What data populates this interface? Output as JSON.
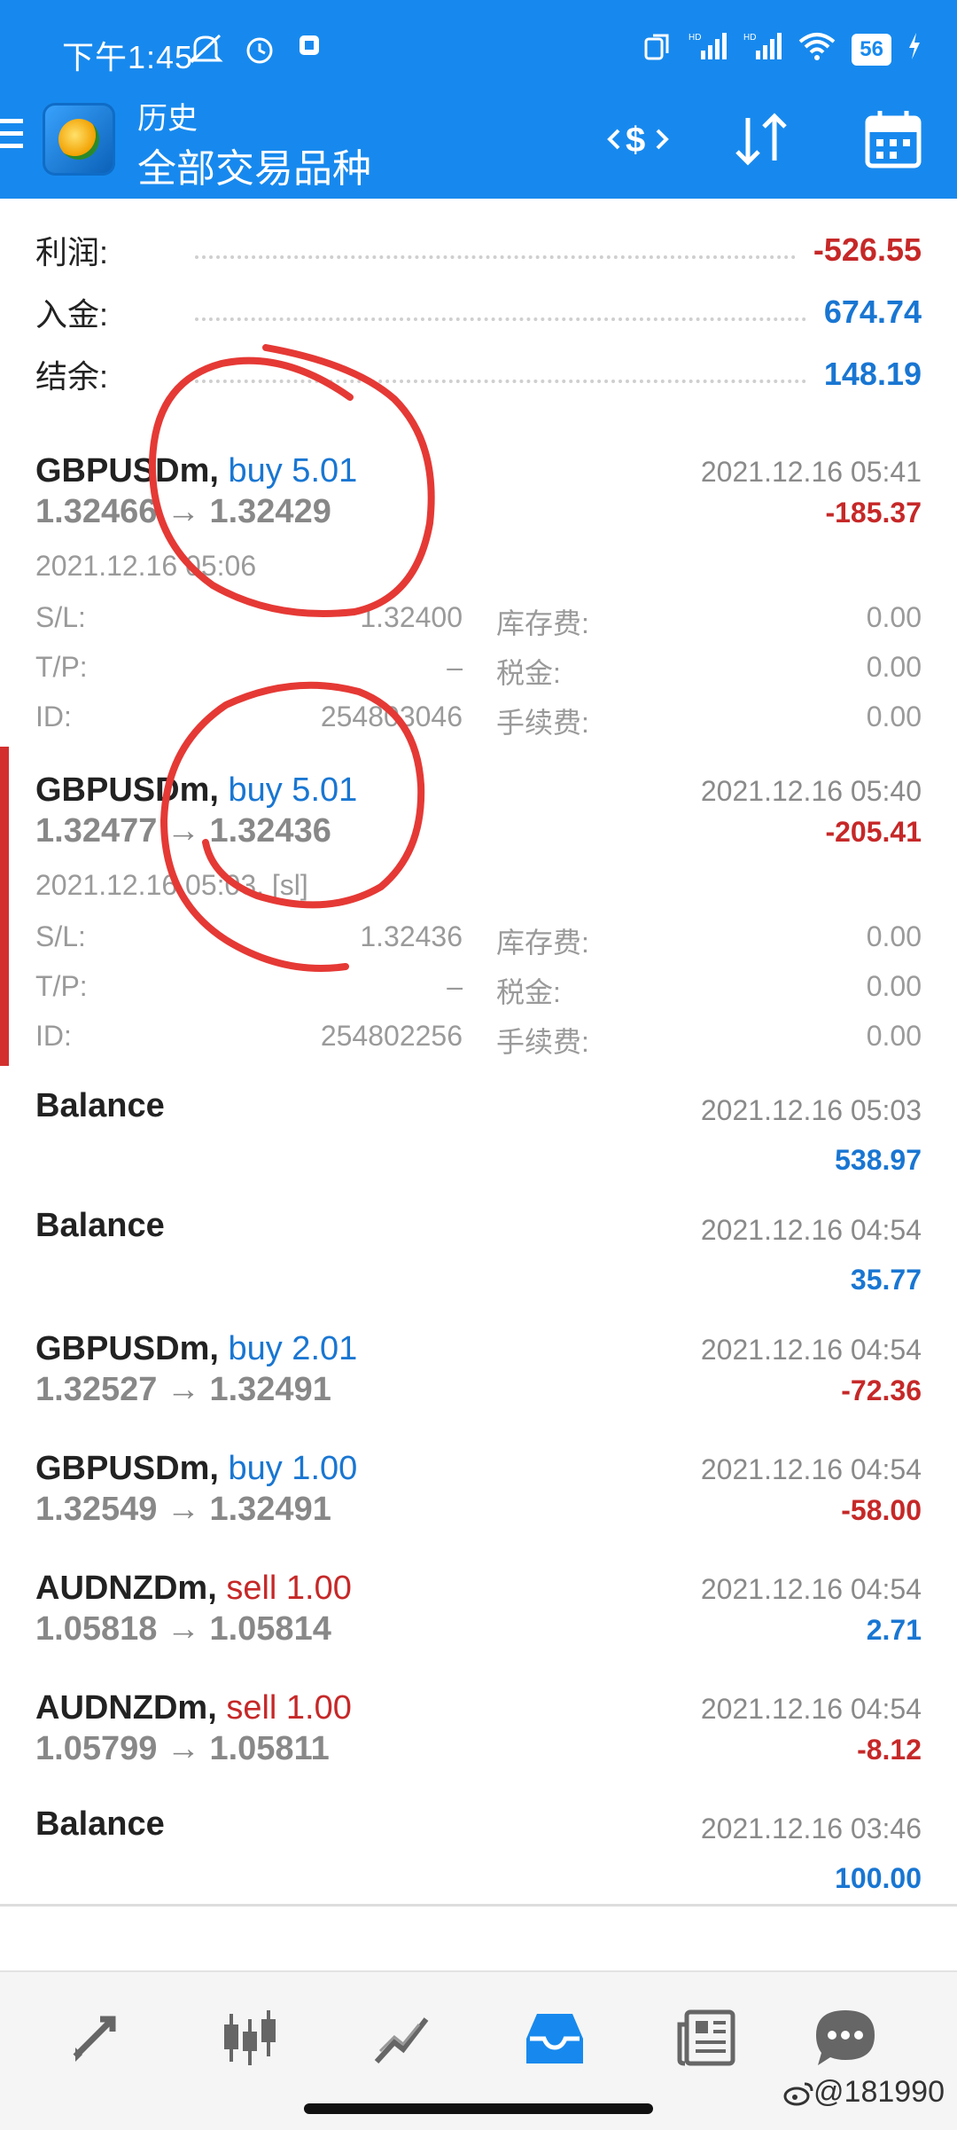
{
  "status_bar": {
    "time": "下午1:45",
    "battery": "56"
  },
  "app_bar": {
    "title": "历史",
    "subtitle": "全部交易品种"
  },
  "summary": {
    "profit_label": "利润:",
    "profit_value": "-526.55",
    "deposit_label": "入金:",
    "deposit_value": "674.74",
    "balance_label": "结余:",
    "balance_value": "148.19"
  },
  "entries": [
    {
      "symbol": "GBPUSDm,",
      "side": "buy 5.01",
      "prices": "1.32466 → 1.32429",
      "close_time": "2021.12.16 05:41",
      "pl": "-185.37",
      "open_time": "2021.12.16 05:06",
      "sl_label": "S/L:",
      "sl": "1.32400",
      "tp_label": "T/P:",
      "tp": "–",
      "id_label": "ID:",
      "id": "254803046",
      "swap_label": "库存费:",
      "swap": "0.00",
      "tax_label": "税金:",
      "tax": "0.00",
      "fee_label": "手续费:",
      "fee": "0.00"
    },
    {
      "symbol": "GBPUSDm,",
      "side": "buy 5.01",
      "prices": "1.32477 → 1.32436",
      "close_time": "2021.12.16 05:40",
      "pl": "-205.41",
      "open_time": "2021.12.16 05:03, [sl]",
      "sl_label": "S/L:",
      "sl": "1.32436",
      "tp_label": "T/P:",
      "tp": "–",
      "id_label": "ID:",
      "id": "254802256",
      "swap_label": "库存费:",
      "swap": "0.00",
      "tax_label": "税金:",
      "tax": "0.00",
      "fee_label": "手续费:",
      "fee": "0.00"
    },
    {
      "symbol": "Balance",
      "close_time": "2021.12.16 05:03",
      "pl": "538.97"
    },
    {
      "symbol": "Balance",
      "close_time": "2021.12.16 04:54",
      "pl": "35.77"
    },
    {
      "symbol": "GBPUSDm,",
      "side": "buy 2.01",
      "prices": "1.32527 → 1.32491",
      "close_time": "2021.12.16 04:54",
      "pl": "-72.36"
    },
    {
      "symbol": "GBPUSDm,",
      "side": "buy 1.00",
      "prices": "1.32549 → 1.32491",
      "close_time": "2021.12.16 04:54",
      "pl": "-58.00"
    },
    {
      "symbol": "AUDNZDm,",
      "side": "sell 1.00",
      "prices": "1.05818 → 1.05814",
      "close_time": "2021.12.16 04:54",
      "pl": "2.71"
    },
    {
      "symbol": "AUDNZDm,",
      "side": "sell 1.00",
      "prices": "1.05799 → 1.05811",
      "close_time": "2021.12.16 04:54",
      "pl": "-8.12"
    },
    {
      "symbol": "Balance",
      "close_time": "2021.12.16 03:46",
      "pl": "100.00"
    }
  ],
  "colors": {
    "accent": "#1789ee",
    "loss": "#c62828",
    "gain": "#1976d2",
    "annotation": "#e53935"
  },
  "nav_icons": [
    "trade-icon",
    "quotes-icon",
    "chart-icon",
    "history-icon",
    "news-icon",
    "chat-icon"
  ],
  "watermark": "@181990"
}
